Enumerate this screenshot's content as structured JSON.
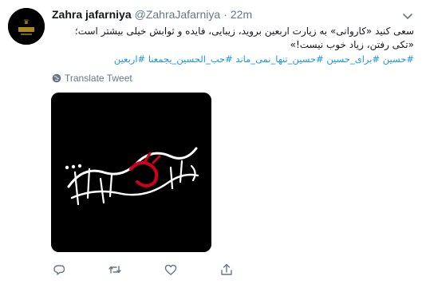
{
  "tweet": {
    "author_name": "Zahra jafarniya",
    "author_handle": "@ZahraJafarniya",
    "separator": "·",
    "time": "22m",
    "text": "سعی کنید «کاروانی» به زیارت اربعین بروید، زیبایی، فایده و ثوابش خیلی بیشتر است؛ «تکی رفتن، زیاد خوب نیست!»",
    "hashtags": [
      "#حسین",
      "#برای_حسین",
      "#حسین_تنها_نمی_ماند",
      "#حب_الحسین_یجمعنا",
      "#اربعین"
    ],
    "translate_label": "Translate Tweet",
    "media_caption": "خدایا ممنونتم به من حسین دادی..."
  },
  "icons": {
    "caret": "chevron-down-icon",
    "translate": "globe-icon",
    "reply": "reply-icon",
    "retweet": "retweet-icon",
    "like": "heart-icon",
    "share": "share-icon"
  },
  "colors": {
    "link": "#1b95e0",
    "muted": "#657786",
    "text": "#14171a",
    "calligraphy_white": "#ffffff",
    "calligraphy_red": "#d0021b"
  }
}
